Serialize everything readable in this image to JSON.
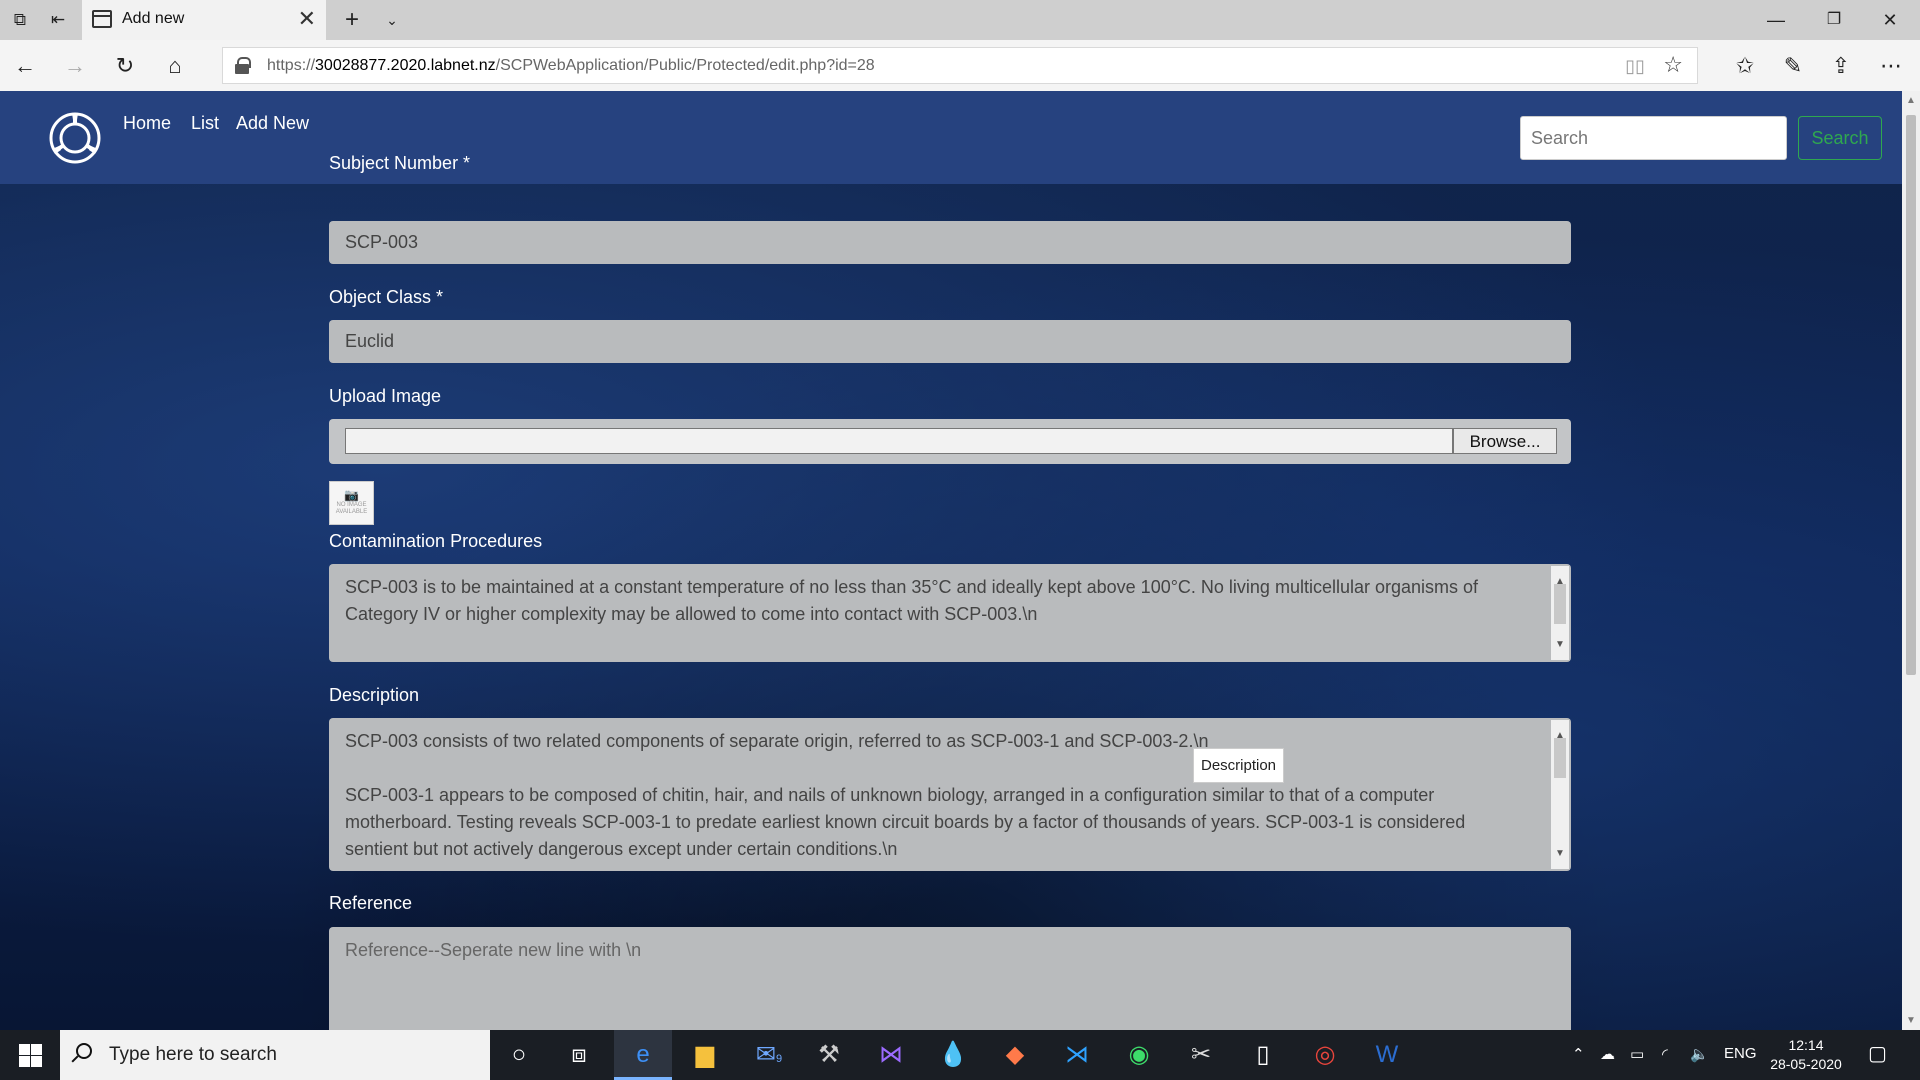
{
  "browser": {
    "tab_title": "Add new",
    "url_prefix": "https://",
    "url_host": "30028877.2020.labnet.nz",
    "url_path": "/SCPWebApplication/Public/Protected/edit.php?id=28"
  },
  "nav": {
    "links": [
      "Home",
      "List",
      "Add New"
    ],
    "search_placeholder": "Search",
    "search_button": "Search"
  },
  "form": {
    "subject_number_label": "Subject Number *",
    "subject_number_value": "SCP-003",
    "object_class_label": "Object Class *",
    "object_class_value": "Euclid",
    "upload_label": "Upload Image",
    "browse_label": "Browse...",
    "no_image_text": "NO IMAGE AVAILABLE",
    "containment_label": "Contamination Procedures",
    "containment_value": "SCP-003 is to be maintained at a constant temperature of no less than 35°C and ideally kept above 100°C. No living multicellular organisms of Category IV or higher complexity may be allowed to come into contact with SCP-003.\\n",
    "description_label": "Description",
    "description_line1": "SCP-003 consists of two related components of separate origin, referred to as SCP-003-1 and SCP-003-2.\\n",
    "description_line2": "SCP-003-1 appears to be composed of chitin, hair, and nails of unknown biology, arranged in a configuration similar to that of a computer motherboard. Testing reveals SCP-003-1 to predate earliest known circuit boards by a factor of thousands of years. SCP-003-1 is considered sentient but not actively dangerous except under certain conditions.\\n",
    "tooltip": "Description",
    "reference_label": "Reference",
    "reference_placeholder": "Reference--Seperate new line with \\n"
  },
  "taskbar": {
    "search_text": "Type here to search",
    "language": "ENG",
    "time": "12:14",
    "date": "28-05-2020",
    "mail_badge": "9"
  }
}
